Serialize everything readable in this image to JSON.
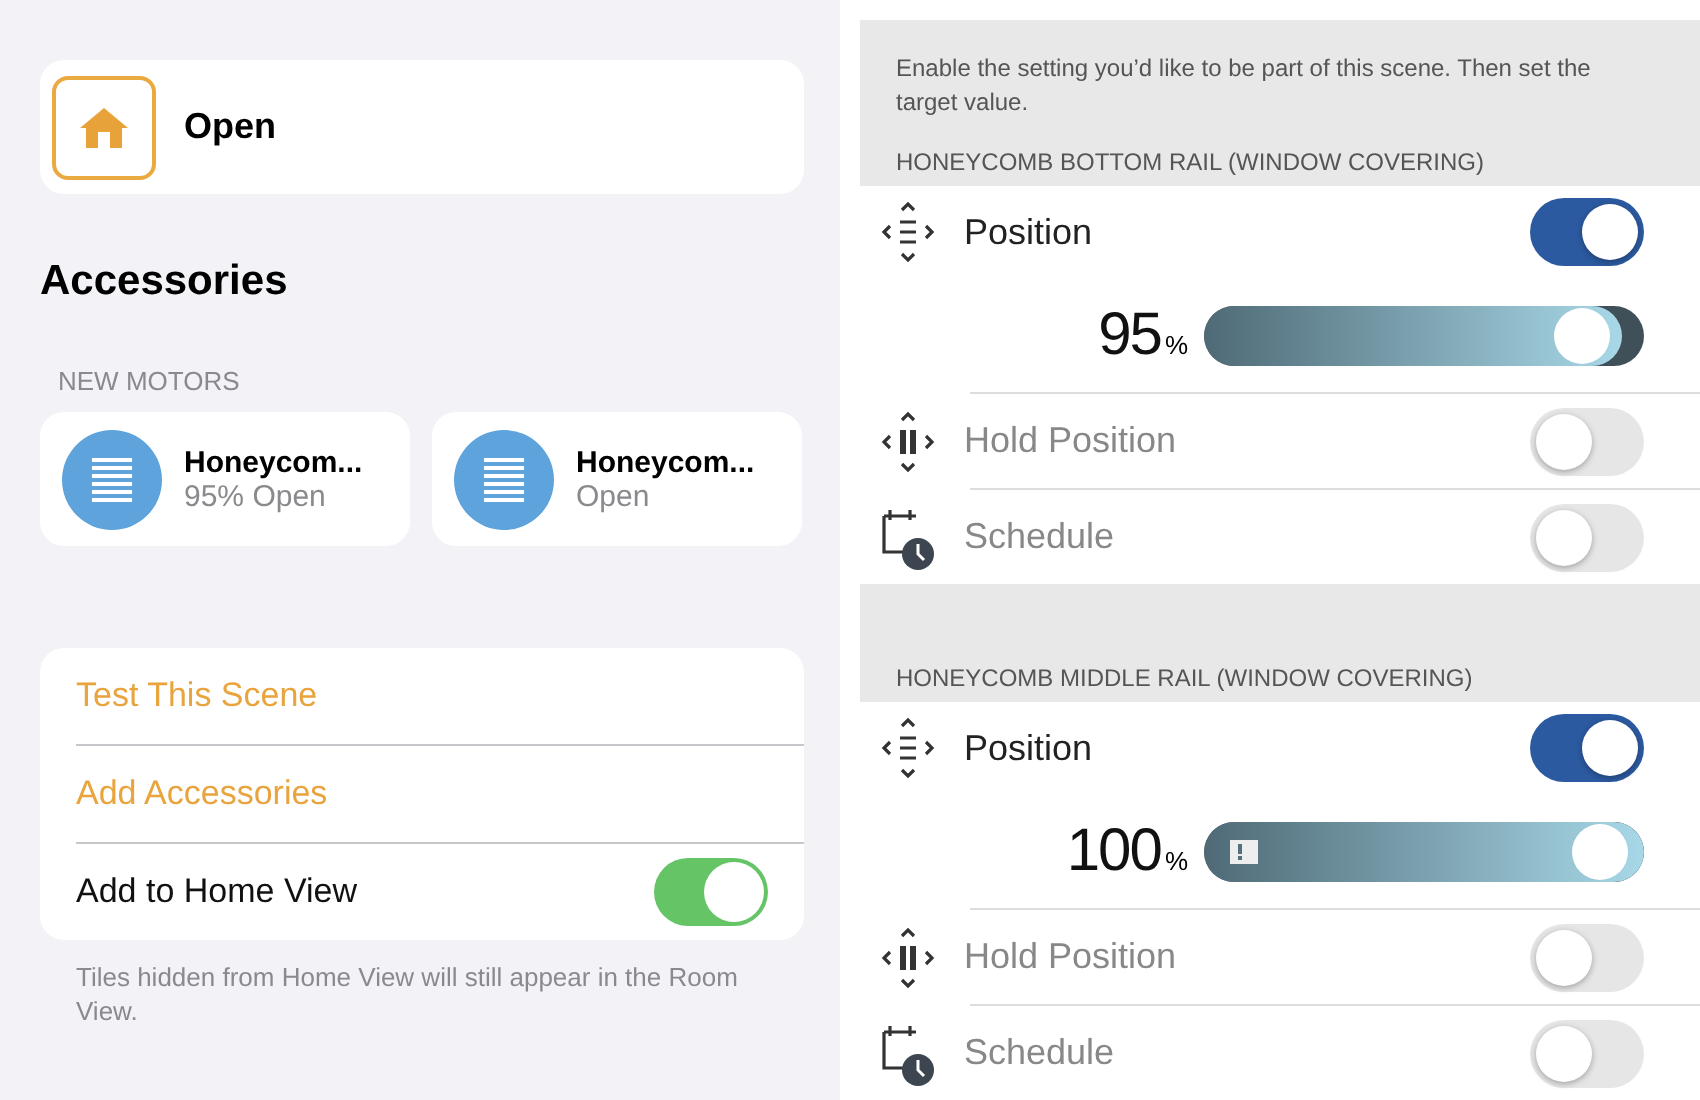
{
  "scene": {
    "name": "Open"
  },
  "accessories": {
    "title": "Accessories",
    "group": "NEW MOTORS",
    "tiles": [
      {
        "name": "Honeycom...",
        "status": "95% Open"
      },
      {
        "name": "Honeycom...",
        "status": "Open"
      }
    ]
  },
  "actions": [
    {
      "kind": "action",
      "label": "Test This Scene"
    },
    {
      "kind": "action",
      "label": "Add Accessories"
    },
    {
      "kind": "toggle",
      "label": "Add to Home View",
      "on": true
    }
  ],
  "actions_note": "Tiles hidden from Home View will still appear in the Room View.",
  "scene_settings": {
    "intro": "Enable the setting you’d like to be part of this scene. Then set the target value.",
    "devices": [
      {
        "title": "HONEYCOMB BOTTOM RAIL (WINDOW COVERING)",
        "rows": [
          {
            "kind": "position",
            "label": "Position",
            "on": true,
            "disabled": false
          },
          {
            "kind": "slider",
            "value": "95",
            "unit": "%",
            "level": 0.95,
            "flag": false
          },
          {
            "kind": "hold",
            "label": "Hold Position",
            "on": false,
            "disabled": true
          },
          {
            "kind": "schedule",
            "label": "Schedule",
            "on": false,
            "disabled": true
          }
        ]
      },
      {
        "title": "HONEYCOMB MIDDLE RAIL (WINDOW COVERING)",
        "rows": [
          {
            "kind": "position",
            "label": "Position",
            "on": true,
            "disabled": false
          },
          {
            "kind": "slider",
            "value": "100",
            "unit": "%",
            "level": 1,
            "flag": true
          },
          {
            "kind": "hold",
            "label": "Hold Position",
            "on": false,
            "disabled": true
          },
          {
            "kind": "schedule",
            "label": "Schedule",
            "on": false,
            "disabled": true
          }
        ]
      }
    ]
  }
}
